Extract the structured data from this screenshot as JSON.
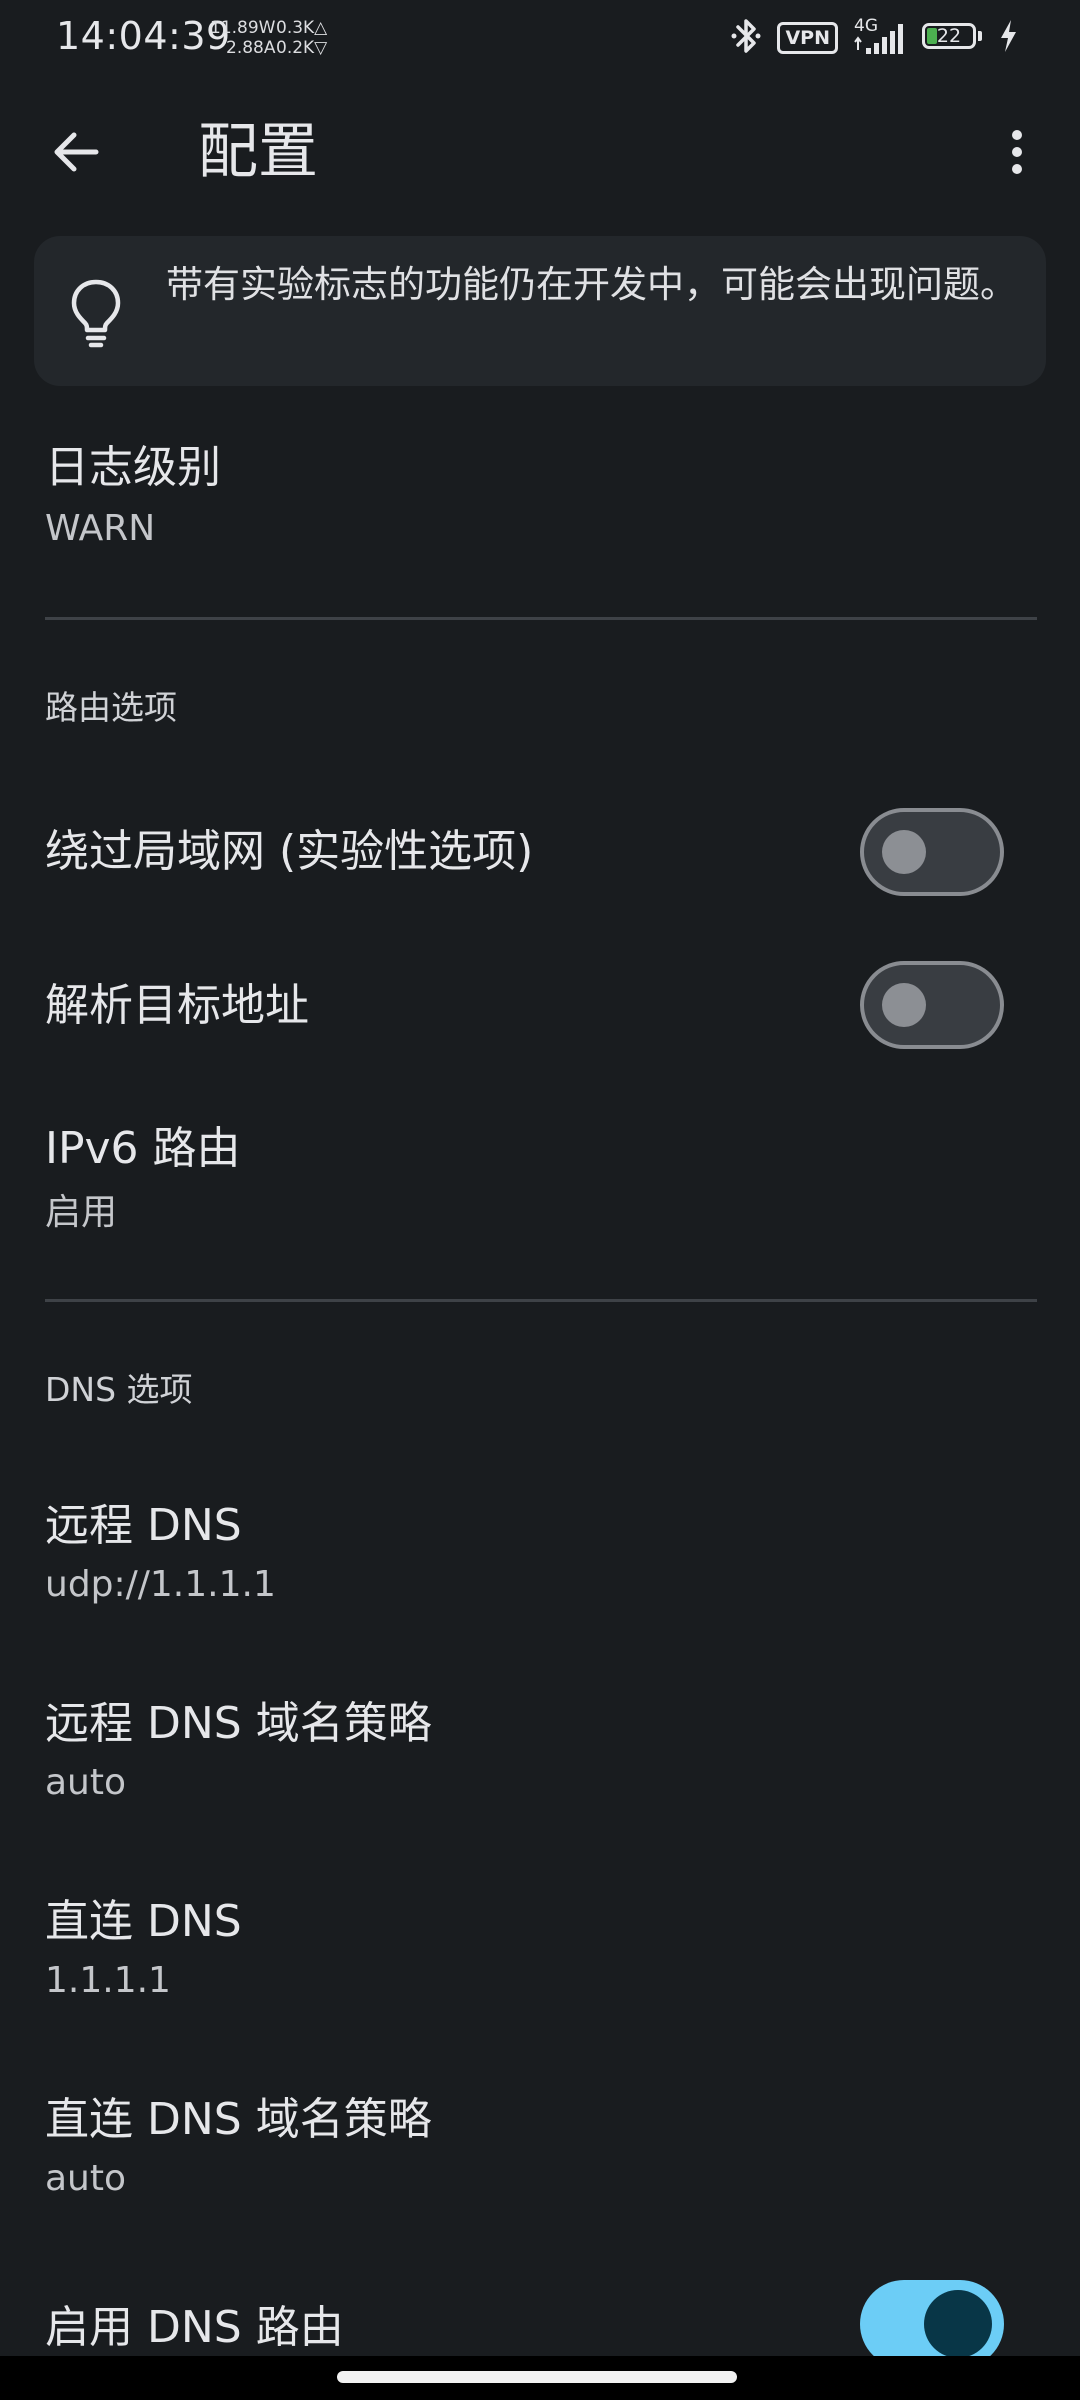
{
  "status_bar": {
    "time": "14:04:39",
    "power_watts": "11.89W",
    "power_amps": "2.88A",
    "net_up": "0.3K△",
    "net_down": "0.2K▽",
    "vpn_label": "VPN",
    "network_type": "4G",
    "battery_level": "22",
    "battery_fraction": 0.22,
    "battery_color": "#4caf50",
    "icons": [
      "bluetooth-icon",
      "vpn-icon",
      "signal-icon",
      "battery-icon",
      "charging-icon"
    ]
  },
  "app_bar": {
    "title": "配置",
    "back_icon": "arrow-left-icon",
    "menu_icon": "more-vert-icon"
  },
  "info_card": {
    "icon": "lightbulb-icon",
    "text": "带有实验标志的功能仍在开发中，可能会出现问题。"
  },
  "log_level": {
    "title": "日志级别",
    "value": "WARN"
  },
  "routing_section": {
    "header": "路由选项",
    "bypass_lan": {
      "title": "绕过局域网 (实验性选项)",
      "enabled": false
    },
    "resolve_destination": {
      "title": "解析目标地址",
      "enabled": false
    },
    "ipv6_route": {
      "title": "IPv6 路由",
      "value": "启用"
    }
  },
  "dns_section": {
    "header": "DNS 选项",
    "remote_dns": {
      "title": "远程 DNS",
      "value": "udp://1.1.1.1"
    },
    "remote_dns_strategy": {
      "title": "远程 DNS 域名策略",
      "value": "auto"
    },
    "direct_dns": {
      "title": "直连 DNS",
      "value": "1.1.1.1"
    },
    "direct_dns_strategy": {
      "title": "直连 DNS 域名策略",
      "value": "auto"
    },
    "enable_dns_routing": {
      "title": "启用 DNS 路由",
      "enabled": true
    }
  },
  "colors": {
    "background": "#191c1f",
    "card": "#23272b",
    "accent": "#6ccdf6",
    "switch_off_track": "#393d42"
  }
}
